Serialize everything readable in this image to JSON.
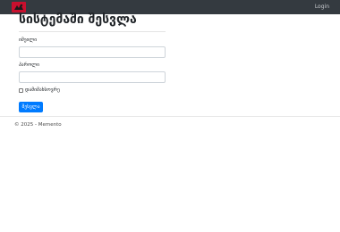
{
  "navbar": {
    "logo_icon": "brand-logo-icon",
    "login_label": "Login",
    "background": "#343a40"
  },
  "page": {
    "title": "სისტემაში შესვლა"
  },
  "form": {
    "username_label": "იმეილი",
    "username_value": "",
    "password_label": "პაროლი",
    "password_value": "",
    "remember_label": "დამიმახსოვრე",
    "remember_checked": false,
    "submit_label": "შესვლა",
    "accent": "#007bff"
  },
  "footer": {
    "text": "© 2025 - Memento"
  }
}
